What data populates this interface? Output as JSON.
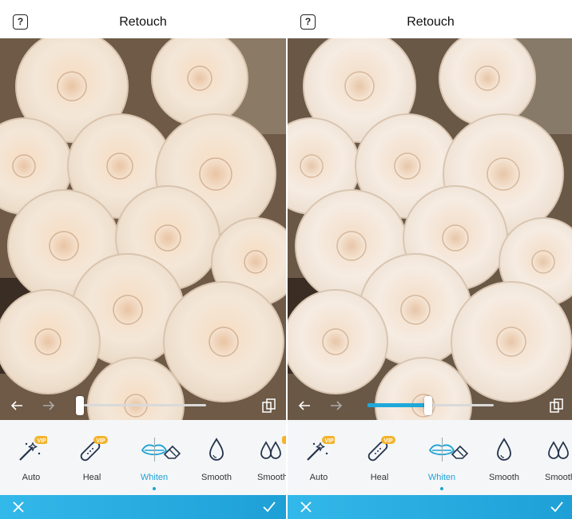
{
  "screens": [
    {
      "title": "Retouch",
      "help_icon": "?",
      "slider": {
        "value": 0
      },
      "tools": [
        {
          "label": "Auto",
          "badge": "VIP",
          "icon": "magic-wand-icon"
        },
        {
          "label": "Heal",
          "badge": "VIP",
          "icon": "bandage-icon"
        },
        {
          "label": "Whiten",
          "badge": "",
          "icon": "lips-icon",
          "active": true
        },
        {
          "label": "Smooth",
          "badge": "",
          "icon": "drop-icon"
        },
        {
          "label": "Smooth",
          "badge": "",
          "icon": "drops-icon"
        }
      ]
    },
    {
      "title": "Retouch",
      "help_icon": "?",
      "slider": {
        "value": 0.5
      },
      "tools": [
        {
          "label": "Auto",
          "badge": "VIP",
          "icon": "magic-wand-icon"
        },
        {
          "label": "Heal",
          "badge": "VIP",
          "icon": "bandage-icon"
        },
        {
          "label": "Whiten",
          "badge": "",
          "icon": "lips-icon",
          "active": true
        },
        {
          "label": "Smooth",
          "badge": "",
          "icon": "drop-icon"
        },
        {
          "label": "Smooth",
          "badge": "",
          "icon": "drops-icon"
        }
      ]
    }
  ],
  "colors": {
    "accent": "#1ea2d6",
    "bar_start": "#33b8ea",
    "bar_end": "#1ea0d6"
  }
}
